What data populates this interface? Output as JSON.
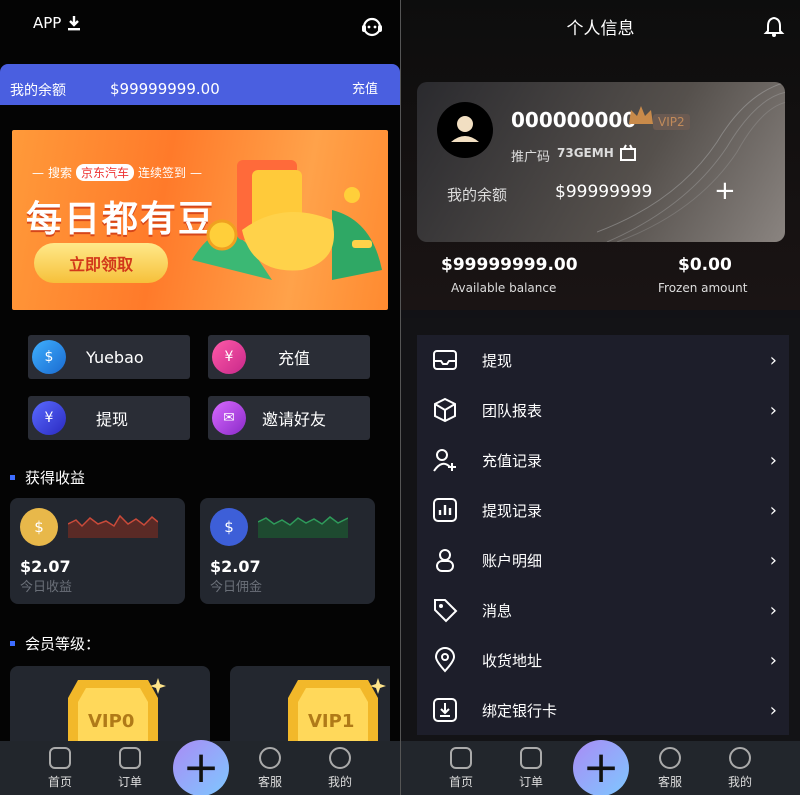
{
  "left": {
    "app_label": "APP",
    "balance_label": "我的余额",
    "balance_value": "$99999999.00",
    "recharge_link": "充值",
    "banner": {
      "tag_pre": "搜索",
      "tag_brand": "京东汽车",
      "tag_post": "连续签到",
      "headline": "每日都有豆",
      "cta": "立即领取"
    },
    "quick_actions": [
      {
        "label": "Yuebao",
        "icon": "yuebao-icon"
      },
      {
        "label": "充值",
        "icon": "recharge-icon"
      },
      {
        "label": "提现",
        "icon": "withdraw-icon"
      },
      {
        "label": "邀请好友",
        "icon": "invite-icon"
      }
    ],
    "earnings_title": "获得收益",
    "earnings": [
      {
        "value": "$2.07",
        "label": "今日收益",
        "color": "#c94a3a"
      },
      {
        "value": "$2.07",
        "label": "今日佣金",
        "color": "#2e9a5a"
      }
    ],
    "level_title": "会员等级：",
    "levels": [
      "VIP0",
      "VIP1"
    ]
  },
  "right": {
    "title": "个人信息",
    "username": "000000000",
    "vip": "VIP2",
    "promo_label": "推广码",
    "promo_code": "73GEMH",
    "balance_label": "我的余额",
    "balance_value": "$99999999",
    "available_value": "$99999999.00",
    "available_label": "Available balance",
    "frozen_value": "$0.00",
    "frozen_label": "Frozen amount",
    "menu": [
      {
        "label": "提现",
        "icon": "inbox-icon"
      },
      {
        "label": "团队报表",
        "icon": "cube-icon"
      },
      {
        "label": "充值记录",
        "icon": "user-add-icon"
      },
      {
        "label": "提现记录",
        "icon": "bar-chart-icon"
      },
      {
        "label": "账户明细",
        "icon": "person-icon"
      },
      {
        "label": "消息",
        "icon": "tag-icon"
      },
      {
        "label": "收货地址",
        "icon": "location-icon"
      },
      {
        "label": "绑定银行卡",
        "icon": "download-icon"
      }
    ]
  },
  "tabs": [
    {
      "label": "首页",
      "icon": "home-icon"
    },
    {
      "label": "订单",
      "icon": "order-icon"
    },
    {
      "label": "客服",
      "icon": "chat-icon"
    },
    {
      "label": "我的",
      "icon": "profile-icon"
    }
  ],
  "colors": {
    "accent": "#4a5fe0",
    "panel": "#23272f",
    "menu_bg": "#1d1e2a"
  }
}
